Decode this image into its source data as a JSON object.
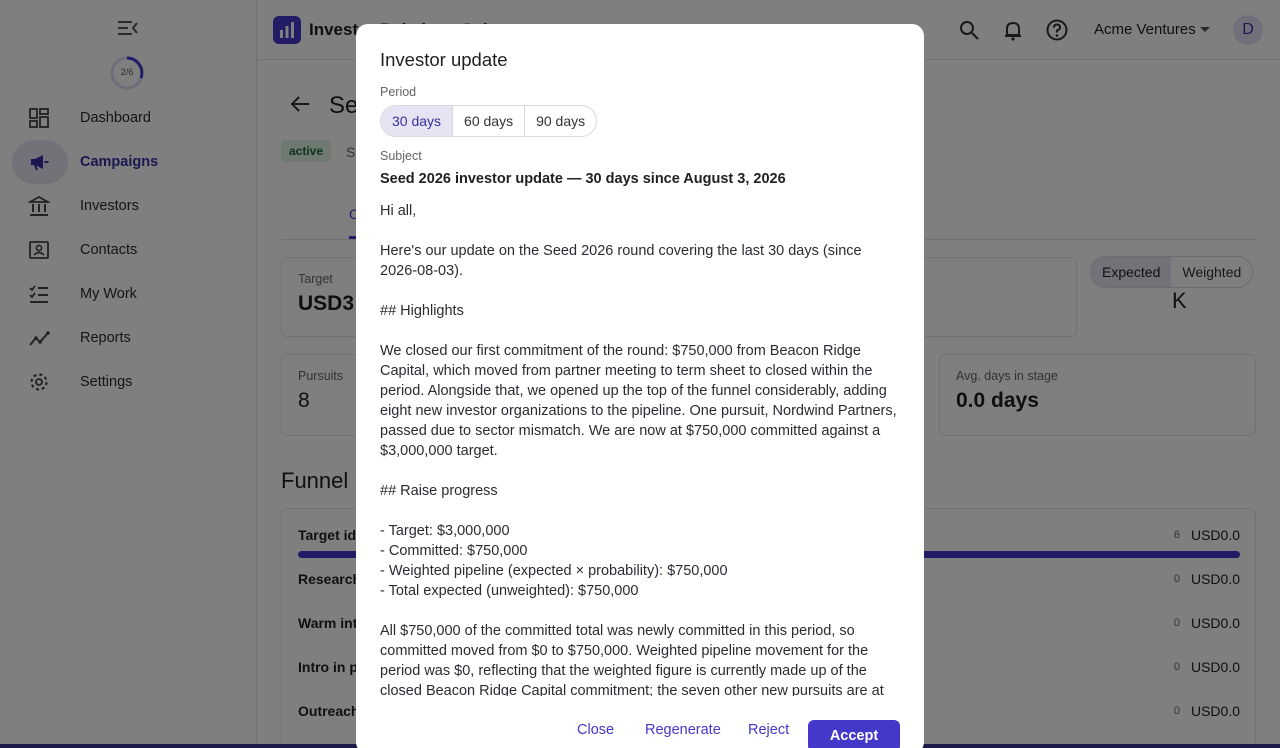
{
  "app": {
    "title": "Investor Relations Suite"
  },
  "sidebar": {
    "progress_label": "2/6",
    "progress_fraction": 0.333,
    "items": [
      {
        "label": "Dashboard",
        "icon": "dashboard-icon"
      },
      {
        "label": "Campaigns",
        "icon": "megaphone-icon",
        "active": true
      },
      {
        "label": "Investors",
        "icon": "bank-icon"
      },
      {
        "label": "Contacts",
        "icon": "contact-card-icon"
      },
      {
        "label": "My Work",
        "icon": "checklist-icon"
      },
      {
        "label": "Reports",
        "icon": "trend-icon"
      },
      {
        "label": "Settings",
        "icon": "gear-icon"
      }
    ]
  },
  "topbar": {
    "org_name": "Acme Ventures",
    "avatar_initial": "D"
  },
  "page": {
    "title_fragment": "Se",
    "status": "active",
    "sub_fragment": "S",
    "tab_fragment": "C",
    "target_label": "Target",
    "target_value_fragment": "USD3",
    "right_fragment": "K",
    "pursuits_label": "Pursuits",
    "pursuits_value": "8",
    "avg_days_label": "Avg. days in stage",
    "avg_days_value": "0.0 days",
    "toggle": {
      "expected": "Expected",
      "weighted": "Weighted"
    },
    "funnel_title": "Funnel",
    "funnel_rows": [
      {
        "label": "Target ide",
        "count": "6",
        "amount": "USD0.0"
      },
      {
        "label": "Research",
        "count": "0",
        "amount": "USD0.0"
      },
      {
        "label": "Warm int",
        "count": "0",
        "amount": "USD0.0"
      },
      {
        "label": "Intro in p",
        "count": "0",
        "amount": "USD0.0"
      },
      {
        "label": "Outreach",
        "count": "0",
        "amount": "USD0.0"
      }
    ]
  },
  "modal": {
    "title": "Investor update",
    "period_label": "Period",
    "periods": [
      "30 days",
      "60 days",
      "90 days"
    ],
    "selected_period": "30 days",
    "subject_label": "Subject",
    "subject": "Seed 2026 investor update — 30 days since August 3, 2026",
    "body": "Hi all,\n\nHere's our update on the Seed 2026 round covering the last 30 days (since\n2026-08-03).\n\n## Highlights\n\nWe closed our first commitment of the round: $750,000 from Beacon Ridge\nCapital, which moved from partner meeting to term sheet to closed within the\nperiod. Alongside that, we opened up the top of the funnel considerably, adding\neight new investor organizations to the pipeline. One pursuit, Nordwind Partners,\npassed due to sector mismatch. We are now at $750,000 committed against a\n$3,000,000 target.\n\n## Raise progress\n\n- Target: $3,000,000\n- Committed: $750,000\n- Weighted pipeline (expected × probability): $750,000\n- Total expected (unweighted): $750,000\n\nAll $750,000 of the committed total was newly committed in this period, so\ncommitted moved from $0 to $750,000. Weighted pipeline movement for the\nperiod was $0, reflecting that the weighted figure is currently made up of the\nclosed Beacon Ridge Capital commitment; the seven other new pursuits are at",
    "actions": {
      "close": "Close",
      "regenerate": "Regenerate",
      "reject": "Reject",
      "accept": "Accept"
    }
  },
  "colors": {
    "accent": "#4338ca",
    "active_bg": "#e6e4f3",
    "badge_bg": "#dff3e4",
    "badge_text": "#1e6b35"
  }
}
